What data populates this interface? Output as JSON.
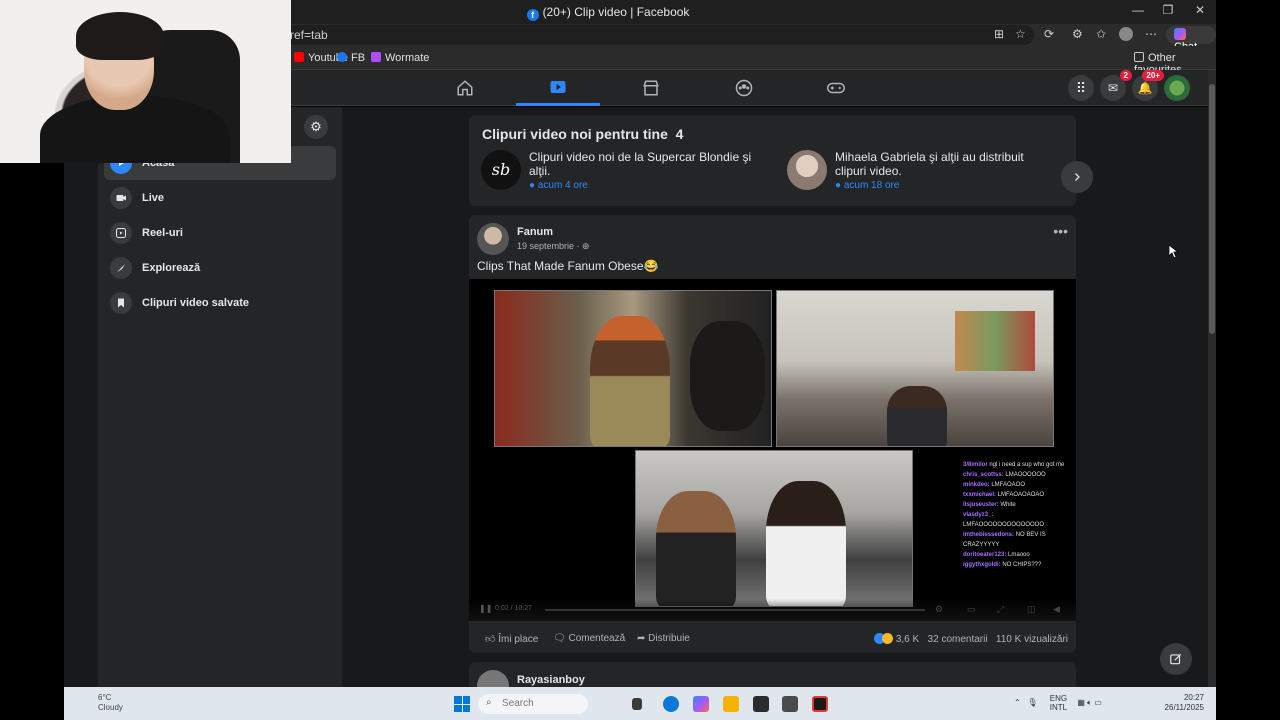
{
  "browser": {
    "tab_title": "(20+) Clip video | Facebook",
    "address": "ref=tab",
    "chat_label": "Chat",
    "bookmarks": [
      {
        "label": "Youtube",
        "color": "#ff0000"
      },
      {
        "label": "FB",
        "color": "#1877f2"
      },
      {
        "label": "Wormate",
        "color": "#b04dff"
      }
    ],
    "other_favourites": "Other favourites"
  },
  "fb_nav": {
    "messenger_badge": "2",
    "notifications_badge": "20+"
  },
  "sidebar": {
    "items": [
      {
        "label": "Acasă",
        "icon": "video-home-icon"
      },
      {
        "label": "Live",
        "icon": "live-icon"
      },
      {
        "label": "Reel-uri",
        "icon": "reels-icon"
      },
      {
        "label": "Explorează",
        "icon": "explore-icon"
      },
      {
        "label": "Clipuri video salvate",
        "icon": "bookmark-icon"
      }
    ]
  },
  "new_videos": {
    "title": "Clipuri video noi pentru tine",
    "count": "4",
    "items": [
      {
        "text": "Clipuri video noi de la Supercar Blondie şi alţii.",
        "time": "acum 4 ore",
        "avatar_label": "sb"
      },
      {
        "text": "Mihaela Gabriela şi alţii au distribuit clipuri video.",
        "time": "acum 18 ore"
      }
    ]
  },
  "post": {
    "author": "Fanum",
    "date": "19 septembrie · ",
    "caption": "Clips That Made Fanum Obese😂",
    "video_time": "0:02 / 10:27",
    "chat_lines": [
      {
        "user": "3/8imilor",
        "msg": "ngl i need a sup who got me"
      },
      {
        "user": "chris_scottss:",
        "msg": "LMAOOOOOO"
      },
      {
        "user": "minkdeo:",
        "msg": "LMFAOAOO"
      },
      {
        "user": "txxmichael:",
        "msg": "LMFAOAOAOAO"
      },
      {
        "user": "itsjuseuster:",
        "msg": "White"
      },
      {
        "user": "vlasdyz3_:",
        "msg": "LMFAOOOOOOOOOOOOOO"
      },
      {
        "user": "imthebiessedons:",
        "msg": "NO BEV IS CRAZYYYYY"
      },
      {
        "user": "doritoeater123:",
        "msg": "Lmaooo"
      },
      {
        "user": "iggythxgoldi:",
        "msg": "NO CHIPS???"
      }
    ],
    "actions": {
      "like": "Îmi place",
      "comment": "Comentează",
      "share": "Distribuie"
    },
    "stats": {
      "reactions": "3,6 K",
      "comments": "32 comentarii",
      "views": "110 K vizualizări"
    }
  },
  "next_post": {
    "author": "Rayasianboy"
  },
  "taskbar": {
    "weather_temp": "6°C",
    "weather_desc": "Cloudy",
    "search_placeholder": "Search",
    "lang_line1": "ENG",
    "lang_line2": "INTL",
    "time": "20:27",
    "date": "26/11/2025"
  }
}
